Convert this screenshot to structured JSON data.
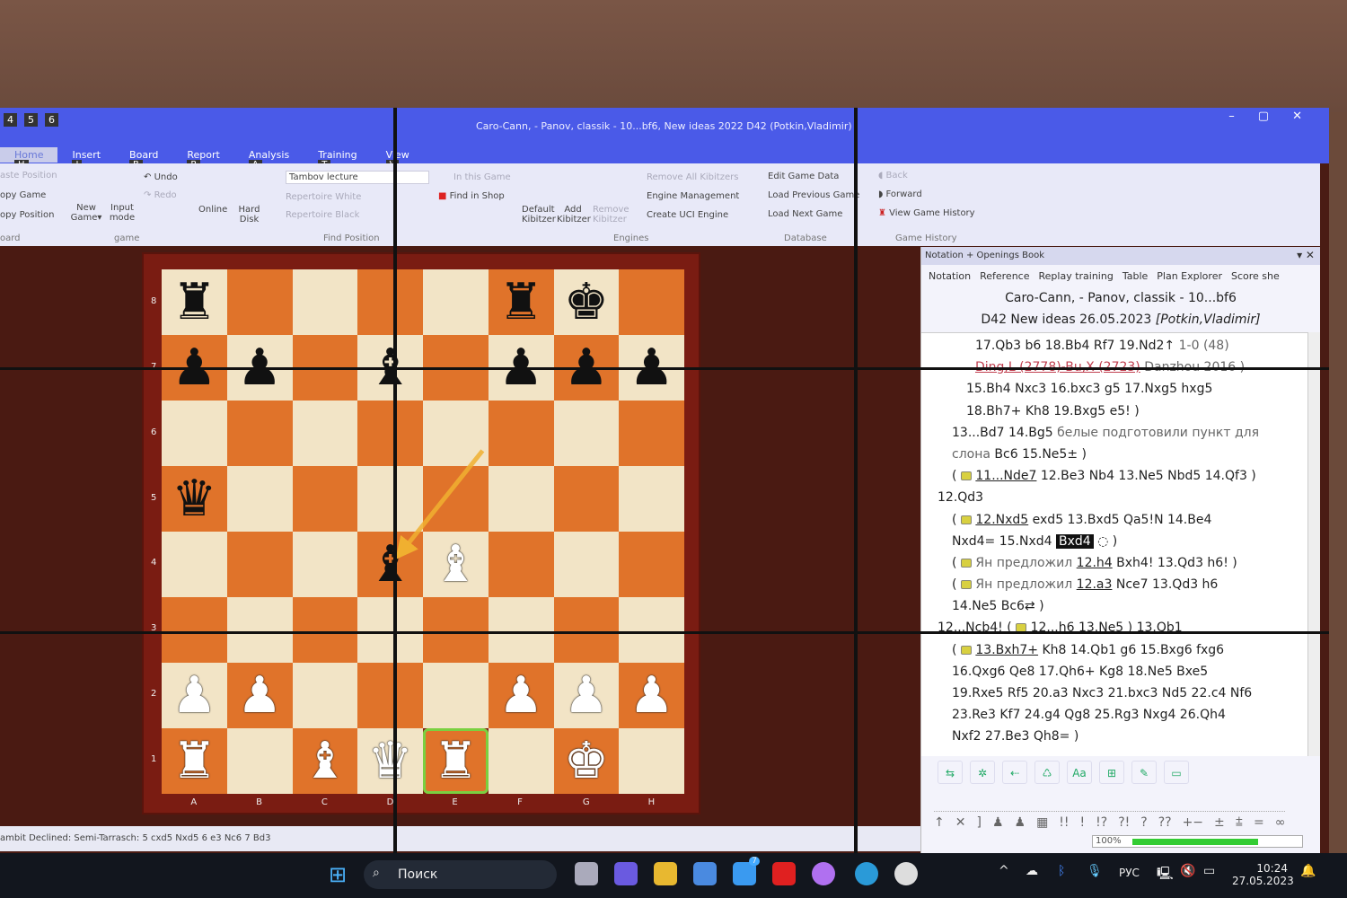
{
  "window": {
    "title": "Caro-Cann, - Panov, classik - 10...bf6, New ideas 2022  D42  (Potkin,Vladimir)",
    "quick_access": [
      "4",
      "5",
      "6"
    ],
    "controls": [
      "–",
      "▢",
      "✕"
    ]
  },
  "tabs": [
    {
      "label": "Home",
      "key": "H"
    },
    {
      "label": "Insert",
      "key": "I"
    },
    {
      "label": "Board",
      "key": "B"
    },
    {
      "label": "Report",
      "key": "R"
    },
    {
      "label": "Analysis",
      "key": "A"
    },
    {
      "label": "Training",
      "key": "T"
    },
    {
      "label": "View",
      "key": "V"
    }
  ],
  "ribbon": {
    "clipboard": {
      "items": [
        "aste Position",
        "opy Game",
        "opy Position"
      ],
      "group": "oard"
    },
    "game": {
      "new_game": "New Game▾",
      "input_mode": "Input mode",
      "undo": "Undo",
      "redo": "Redo",
      "group": "game"
    },
    "find": {
      "online": "Online",
      "hard_disk": "Hard Disk",
      "search_value": "Tambov lecture",
      "rep_white": "Repertoire White",
      "rep_black": "Repertoire Black",
      "in_game": "In this Game",
      "shop": "Find in Shop",
      "group": "Find Position"
    },
    "engines": {
      "default": "Default Kibitzer",
      "add": "Add Kibitzer",
      "remove": "Remove Kibitzer",
      "remove_all": "Remove All Kibitzers",
      "manage": "Engine Management",
      "create": "Create UCI Engine",
      "group": "Engines"
    },
    "database": {
      "edit": "Edit Game Data",
      "prev": "Load Previous Game",
      "next": "Load Next Game",
      "group": "Database"
    },
    "history": {
      "back": "Back",
      "forward": "Forward",
      "view": "View Game History",
      "group": "Game History"
    }
  },
  "board": {
    "ranks": [
      "8",
      "7",
      "6",
      "5",
      "4",
      "3",
      "2",
      "1"
    ],
    "files": [
      "A",
      "B",
      "C",
      "D",
      "E",
      "F",
      "G",
      "H"
    ],
    "position": [
      [
        "r",
        "",
        "",
        "",
        "",
        "r",
        "k",
        ""
      ],
      [
        "p",
        "p",
        "",
        "b",
        "",
        "p",
        "p",
        "p"
      ],
      [
        "",
        "",
        "",
        "",
        "",
        "",
        "",
        ""
      ],
      [
        "q",
        "",
        "",
        "",
        "",
        "",
        "",
        ""
      ],
      [
        "",
        "",
        "",
        "b",
        "B",
        "",
        "",
        ""
      ],
      [
        "",
        "",
        "",
        "",
        "",
        "",
        "",
        ""
      ],
      [
        "P",
        "P",
        "",
        "",
        "",
        "P",
        "P",
        "P"
      ],
      [
        "R",
        "",
        "B",
        "Q",
        "R",
        "",
        "K",
        ""
      ]
    ],
    "highlight": "e1",
    "arrow": {
      "from": "e6",
      "to": "d4",
      "color": "#f0b030"
    }
  },
  "status_bar": "ambit Declined: Semi-Tarrasch: 5 cxd5 Nxd5 6 e3 Nc6 7 Bd3",
  "panel": {
    "title": "Notation + Openings Book",
    "tabs": [
      "Notation",
      "Reference",
      "Replay training",
      "Table",
      "Plan Explorer",
      "Score she"
    ],
    "game_title": "Caro-Cann, - Panov, classik - 10...bf6",
    "game_sub": "D42 New ideas 26.05.2023",
    "game_author": "[Potkin,Vladimir]",
    "lines": [
      [
        {
          "i": 60,
          "t": "17.Qb3  b6  18.Bb4  Rf7  19.Nd2↑ "
        },
        {
          "t": "1-0 (48)",
          "c": "gray"
        }
      ],
      [
        {
          "i": 60,
          "t": "Ding,L (2778)-Bu,X (2723)",
          "c": "red"
        },
        {
          "t": " Danzhou 2016 )",
          "c": "gray"
        }
      ],
      [
        {
          "i": 50,
          "t": "15.Bh4  Nxc3  16.bxc3  g5  17.Nxg5  hxg5"
        }
      ],
      [
        {
          "i": 50,
          "t": "18.Bh7+  Kh8  19.Bxg5  e5! )"
        }
      ],
      [
        {
          "i": 34,
          "t": "13...Bd7  14.Bg5 "
        },
        {
          "t": "белые подготовили пункт для",
          "c": "gray"
        }
      ],
      [
        {
          "i": 34,
          "t": "слона",
          "c": "gray"
        },
        {
          "t": "  Bc6  15.Ne5± )"
        }
      ],
      [
        {
          "i": 34,
          "t": "( "
        },
        {
          "box": true
        },
        {
          "t": " "
        },
        {
          "t": "11...Nde7",
          "c": "ul"
        },
        {
          "t": "  12.Be3  Nb4  13.Ne5  Nbd5  14.Qf3 )"
        }
      ],
      [
        {
          "i": 18,
          "t": "12.Qd3"
        }
      ],
      [
        {
          "i": 34,
          "t": "( "
        },
        {
          "box": true
        },
        {
          "t": " "
        },
        {
          "t": "12.Nxd5",
          "c": "ul"
        },
        {
          "t": "  exd5  13.Bxd5  Qa5!N  14.Be4"
        }
      ],
      [
        {
          "i": 34,
          "t": "Nxd4=  15.Nxd4 "
        },
        {
          "t": "Bxd4",
          "c": "cur"
        },
        {
          "t": " ◌ )"
        }
      ],
      [
        {
          "i": 34,
          "t": "( "
        },
        {
          "box": true
        },
        {
          "t": " Ян предложил ",
          "c": "gray"
        },
        {
          "t": "12.h4",
          "c": "ul"
        },
        {
          "t": "  Bxh4!  13.Qd3  h6! )"
        }
      ],
      [
        {
          "i": 34,
          "t": "( "
        },
        {
          "box": true
        },
        {
          "t": " Ян предложил ",
          "c": "gray"
        },
        {
          "t": "12.a3",
          "c": "ul"
        },
        {
          "t": "  Nce7  13.Qd3  h6"
        }
      ],
      [
        {
          "i": 34,
          "t": "14.Ne5  Bc6⇄ )"
        }
      ],
      [
        {
          "i": 18,
          "t": "12...Ncb4!  ( "
        },
        {
          "box": true
        },
        {
          "t": " "
        },
        {
          "t": "12...h6  13.Ne5",
          "c": "ul"
        },
        {
          "t": " ) 13.Qb1"
        }
      ],
      [
        {
          "i": 34,
          "t": "( "
        },
        {
          "box": true
        },
        {
          "t": " "
        },
        {
          "t": "13.Bxh7+",
          "c": "ul"
        },
        {
          "t": "  Kh8  14.Qb1  g6  15.Bxg6  fxg6"
        }
      ],
      [
        {
          "i": 34,
          "t": "16.Qxg6  Qe8  17.Qh6+  Kg8  18.Ne5  Bxe5"
        }
      ],
      [
        {
          "i": 34,
          "t": "19.Rxe5  Rf5  20.a3  Nxc3  21.bxc3  Nd5  22.c4  Nf6"
        }
      ],
      [
        {
          "i": 34,
          "t": "23.Re3  Kf7  24.g4  Qg8  25.Rg3  Nxg4  26.Qh4"
        }
      ],
      [
        {
          "i": 34,
          "t": "Nxf2  27.Be3  Qh8= )"
        }
      ]
    ],
    "tool_icons": [
      "insert-variation-icon",
      "promote-icon",
      "delete-icon",
      "loop-icon",
      "font-icon",
      "tree-icon",
      "pen-icon",
      "eraser-icon"
    ],
    "tool_labels": [
      "⇆",
      "✲",
      "⇠",
      "♺",
      "Aa",
      "⊞",
      "✎",
      "▭"
    ],
    "symbols": [
      "↑",
      "✕",
      "]",
      "♟",
      "♟",
      "▦",
      "!!",
      "!",
      "!?",
      "?!",
      "?",
      "??",
      "+−",
      "±",
      "⩲",
      "=",
      "∞"
    ],
    "progress_label": "100%",
    "progress": 100
  },
  "taskbar": {
    "search": "Поиск",
    "lang": "РУС",
    "time": "10:24",
    "date": "27.05.2023",
    "mail_badge": "7"
  }
}
